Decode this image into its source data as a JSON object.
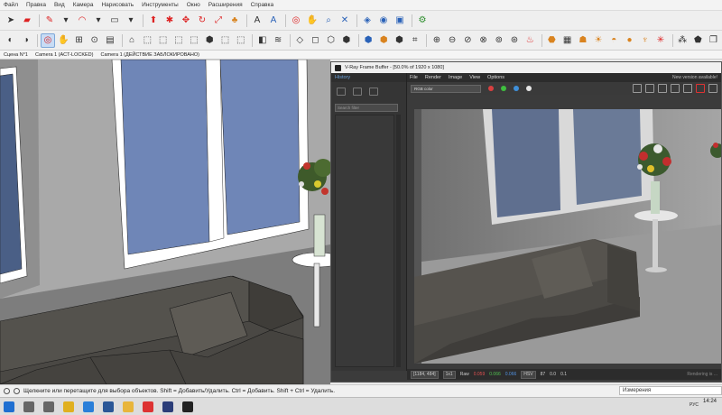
{
  "menu": [
    "Файл",
    "Правка",
    "Вид",
    "Камера",
    "Нарисовать",
    "Инструменты",
    "Окно",
    "Расширения",
    "Справка"
  ],
  "scene_tabs": [
    "Сцена N°1",
    "Camera 1 (ACT-LOCKED)",
    "Camera 1 (ДЕЙСТВИЕ ЗАБЛОКИРОВАНО)"
  ],
  "toolbar1_icons": [
    "select-arrow-icon",
    "eraser-icon",
    "pencil-icon",
    "dropdown-icon",
    "arc-icon",
    "dropdown-icon",
    "rectangle-icon",
    "dropdown-icon",
    "push-pull-icon",
    "follow-me-icon",
    "move-icon",
    "rotate-icon",
    "scale-icon",
    "paint-bucket-icon",
    "text-icon",
    "3d-text-icon",
    "orbit-icon",
    "pan-icon",
    "zoom-icon",
    "zoom-extents-icon",
    "components-icon",
    "materials-icon",
    "styles-icon",
    "extension-warehouse-icon"
  ],
  "toolbar2_icons": [
    "select-tool-icon",
    "paint-icon",
    "orbit-icon",
    "pan-icon",
    "zoom-window-icon",
    "previous-view-icon",
    "section-plane-icon",
    "camera-icon",
    "front-view-icon",
    "back-view-icon",
    "left-view-icon",
    "top-view-icon",
    "iso-view-icon",
    "right-view-icon",
    "bottom-view-icon",
    "shadows-icon",
    "fog-icon",
    "edge-style-icon",
    "xray-icon",
    "wireframe-icon",
    "hidden-line-icon",
    "shaded-icon",
    "textured-icon",
    "monochrome-icon",
    "sandbox-icon",
    "solid-union-icon",
    "solid-subtract-icon",
    "solid-trim-icon",
    "solid-split-icon",
    "outer-shell-icon",
    "intersect-icon",
    "render-icon",
    "interactive-render-icon",
    "frame-buffer-icon",
    "light-icon",
    "sun-icon",
    "dome-light-icon",
    "sphere-light-icon",
    "ies-light-icon",
    "proxy-icon",
    "fur-icon",
    "mesh-light-icon",
    "copy-icon"
  ],
  "vfb": {
    "title": "V-Ray Frame Buffer - [50.0% of 1920 x 1080]",
    "menu": [
      "File",
      "Render",
      "Image",
      "View",
      "Options"
    ],
    "new_version": "New version available!",
    "history_label": "History",
    "search_placeholder": "Search filter",
    "channel": "RGB color",
    "status": {
      "coords": "[1184, 484]",
      "zoom": "1x1",
      "mode": "Raw",
      "r": "0.059",
      "g": "0.066",
      "b": "0.066",
      "space": "HSV",
      "h": "87",
      "s": "0.0",
      "v": "0.1",
      "info": "Rendering is ..."
    },
    "colors": {
      "red": "#d94040",
      "green": "#3fbf3f",
      "blue": "#3f8fd9",
      "white": "#e6e6e6"
    }
  },
  "status_bar": {
    "hint": "Щелкните или перетащите для выбора объектов. Shift = Добавить/Удалить. Ctrl = Добавить. Shift + Ctrl = Удалить.",
    "measurements_label": "Измерения"
  },
  "taskbar": {
    "apps": [
      "start-icon",
      "search-icon",
      "task-view-icon",
      "chrome-icon",
      "edge-icon",
      "word-icon",
      "explorer-icon",
      "sketchup-icon",
      "photoshop-icon",
      "vray-icon"
    ],
    "clock": "14:24",
    "lang": "РУС"
  }
}
